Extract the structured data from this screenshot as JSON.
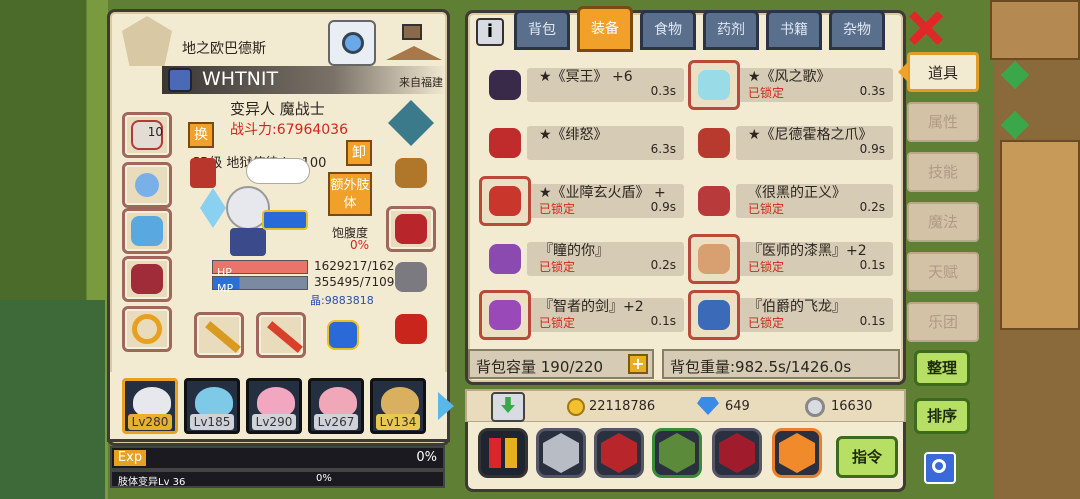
{
  "character": {
    "realm_title": "地之欧巴德斯",
    "player_name": "WHTNIT",
    "origin": "来自福建",
    "race_class": "变异人 魔战士",
    "combat_power": "战斗力:67964036",
    "swap_label": "换",
    "unequip_label": "卸",
    "title_line": "SR级 地狱使徒 Lv 100",
    "extra_limb_label": "额外肢体",
    "satiety_label": "饱腹度",
    "satiety_value": "0%",
    "hp_label": "HP",
    "hp_value": "1629217/162",
    "mp_label": "MP",
    "mp_value": "355495/7109",
    "mana_stone": "晶:9883818",
    "badge_level": "10"
  },
  "party": [
    {
      "level": "Lv280",
      "color": "#e6e8ee"
    },
    {
      "level": "Lv185",
      "color": "#7ec8e8"
    },
    {
      "level": "Lv290",
      "color": "#f2a6c0"
    },
    {
      "level": "Lv267",
      "color": "#f0a8b8"
    },
    {
      "level": "Lv134",
      "color": "#d8b060"
    }
  ],
  "exp": {
    "label": "Exp",
    "value": "0%",
    "limb_label": "肢体变异Lv 36",
    "limb_value": "0%"
  },
  "tabs": [
    {
      "label": "背包",
      "active": false
    },
    {
      "label": "装备",
      "active": true
    },
    {
      "label": "食物",
      "active": false
    },
    {
      "label": "药剂",
      "active": false
    },
    {
      "label": "书籍",
      "active": false
    },
    {
      "label": "杂物",
      "active": false
    }
  ],
  "items": [
    {
      "name": "★《冥王》 +6",
      "locked": "",
      "weight": "0.3s",
      "color": "#3a2a4a"
    },
    {
      "name": "★《风之歌》",
      "locked": "已锁定",
      "weight": "0.3s",
      "color": "#9adbe8"
    },
    {
      "name": "★《绯怒》",
      "locked": "",
      "weight": "6.3s",
      "color": "#c02c2c"
    },
    {
      "name": "★《尼德霍格之爪》",
      "locked": "",
      "weight": "0.9s",
      "color": "#b83a2e"
    },
    {
      "name": "★《业障玄火盾》 +",
      "locked": "已锁定",
      "weight": "0.9s",
      "color": "#c8362c"
    },
    {
      "name": "《很黑的正义》",
      "locked": "已锁定",
      "weight": "0.2s",
      "color": "#b83a3a"
    },
    {
      "name": "『瞳的你』",
      "locked": "已锁定",
      "weight": "0.2s",
      "color": "#8a4ab0"
    },
    {
      "name": "『医师的漆黑』+2",
      "locked": "已锁定",
      "weight": "0.1s",
      "color": "#d8a070"
    },
    {
      "name": "『智者的剑』+2",
      "locked": "已锁定",
      "weight": "0.1s",
      "color": "#9a4ab8"
    },
    {
      "name": "『伯爵的飞龙』",
      "locked": "已锁定",
      "weight": "0.1s",
      "color": "#3a6ab8"
    }
  ],
  "capacity": {
    "label": "背包容量 190/220",
    "weight": "背包重量:982.5s/1426.0s",
    "add": "+"
  },
  "currency": {
    "gold": "22118786",
    "diamond": "649",
    "silver": "16630"
  },
  "side_tabs": [
    {
      "label": "道具",
      "active": true
    },
    {
      "label": "属性",
      "active": false
    },
    {
      "label": "技能",
      "active": false
    },
    {
      "label": "魔法",
      "active": false
    },
    {
      "label": "天赋",
      "active": false
    },
    {
      "label": "乐团",
      "active": false
    }
  ],
  "buttons": {
    "organize": "整理",
    "sort": "排序",
    "command": "指令",
    "info": "i"
  },
  "colors": {
    "panel": "#f3ead2",
    "border": "#3e3a36",
    "locked": "#d3261c",
    "active_tab": "#f1a12a",
    "hp_bar": "#e8746a",
    "mp_bar": "#2a70d8"
  }
}
